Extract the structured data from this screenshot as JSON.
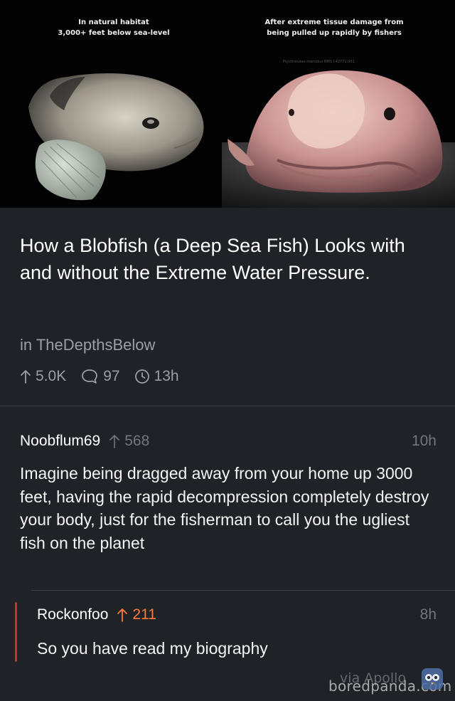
{
  "image": {
    "caption_left_line1": "In natural habitat",
    "caption_left_line2": "3,000+ feet below sea-level",
    "caption_right_line1": "After extreme tissue damage from",
    "caption_right_line2": "being pulled up rapidly by fishers",
    "credit": "Psychrolutes marcidus NMS I.42771.001"
  },
  "post": {
    "title": "How a Blobfish (a Deep Sea Fish) Looks with and without the Extreme Water Pressure.",
    "subreddit_prefix": "in",
    "subreddit": "TheDepthsBelow",
    "upvotes": "5.0K",
    "comments": "97",
    "age": "13h"
  },
  "comments": [
    {
      "user": "Noobflum69",
      "score": "568",
      "time": "10h",
      "body": "Imagine being dragged away from your home up 3000 feet, having the rapid decompression completely destroy your body, just for the fisherman to call you the ugliest fish on the planet"
    },
    {
      "user": "Rockonfoo",
      "score": "211",
      "time": "8h",
      "body": "So you have read my biography"
    }
  ],
  "watermarks": {
    "apollo": "via Apollo",
    "boredpanda": "boredpanda.com"
  },
  "colors": {
    "background": "#1f2227",
    "accent_orange": "#ff7a36",
    "thread_red": "#c9302c",
    "muted_text": "#9a9ea6"
  },
  "icons": {
    "upvote": "arrow-up-icon",
    "comments": "speech-bubble-icon",
    "time": "clock-icon",
    "watermark": "panda-owl-icon"
  }
}
